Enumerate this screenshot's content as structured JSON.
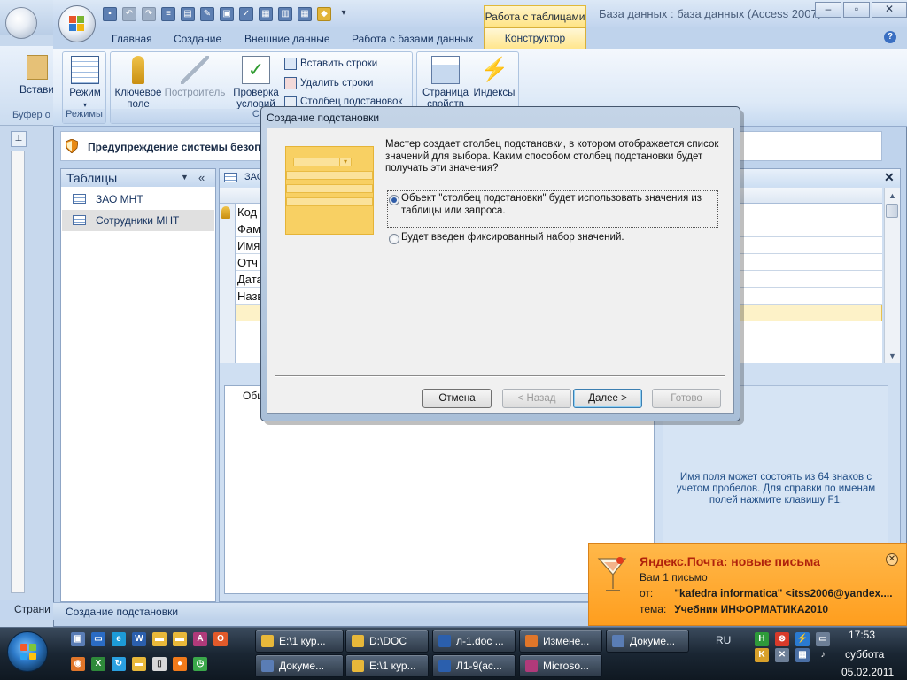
{
  "back_window": {
    "status": "Страни",
    "ribbon_label": "Вставить",
    "group_label": "Буфер о"
  },
  "title_bar": {
    "contextual_group": "Работа с таблицами",
    "title": "База данных : база данных (Access 2007) -"
  },
  "ribbon": {
    "tabs": [
      {
        "label": "Главная"
      },
      {
        "label": "Создание"
      },
      {
        "label": "Внешние данные"
      },
      {
        "label": "Работа с базами данных"
      },
      {
        "label": "Конструктор",
        "active": true
      }
    ],
    "groups": {
      "views": {
        "label": "Режимы",
        "mode_button": "Режим"
      },
      "tools": {
        "label": "Сер",
        "key_field": "Ключевое поле",
        "builder": "Построитель",
        "test_rules": "Проверка условий",
        "insert_rows": "Вставить строки",
        "delete_rows": "Удалить строки",
        "lookup_column": "Столбец подстановок"
      },
      "show_hide": {
        "property_sheet": "Страница свойств",
        "indexes": "Индексы"
      }
    }
  },
  "security_bar": {
    "text": "Предупреждение системы безопас"
  },
  "nav_pane": {
    "header": "Таблицы",
    "items": [
      {
        "label": "ЗАО МНТ",
        "selected": false
      },
      {
        "label": "Сотрудники МНТ",
        "selected": true
      }
    ]
  },
  "designer": {
    "tab_label": "ЗАО",
    "rows": [
      "Код",
      "Фам",
      "Имя",
      "Отч",
      "Дата",
      "Назв"
    ],
    "props_tab": "Общ",
    "help_text": "Имя поля может состоять из 64 знаков с учетом пробелов. Для справки по именам полей нажмите клавишу F1."
  },
  "status_bar": {
    "text": "Создание подстановки"
  },
  "dialog": {
    "title": "Создание подстановки",
    "description": "Мастер создает столбец подстановки, в котором отображается список значений для выбора. Каким способом столбец подстановки будет получать эти значения?",
    "options": [
      {
        "label": "Объект \"столбец подстановки\" будет использовать значения из таблицы или запроса.",
        "checked": true
      },
      {
        "label": "Будет введен фиксированный набор значений.",
        "checked": false
      }
    ],
    "buttons": {
      "cancel": "Отмена",
      "back": "< Назад",
      "next": "Далее >",
      "finish": "Готово"
    }
  },
  "notification": {
    "title": "Яндекс.Почта: новые письма",
    "count": "Вам 1 письмо",
    "from_key": "от:",
    "from_value": "\"kafedra informatica\" <itss2006@yandex....",
    "subject_key": "тема:",
    "subject_value": "Учебник ИНФОРМАТИКА2010"
  },
  "taskbar": {
    "buttons_row1": [
      "E:\\1 кур...",
      "D:\\DOC",
      "л-1.doc ...",
      "Измене...",
      "Докуме..."
    ],
    "buttons_row2": [
      "Докуме...",
      "E:\\1 кур...",
      "Л1-9(ас...",
      "Microso..."
    ],
    "language": "RU",
    "time": "17:53",
    "day": "суббота",
    "date": "05.02.2011"
  },
  "colors": {
    "accent_tab": "#ffe58a",
    "notification": "#ff9e1e",
    "title_accent": "#b0220c"
  }
}
